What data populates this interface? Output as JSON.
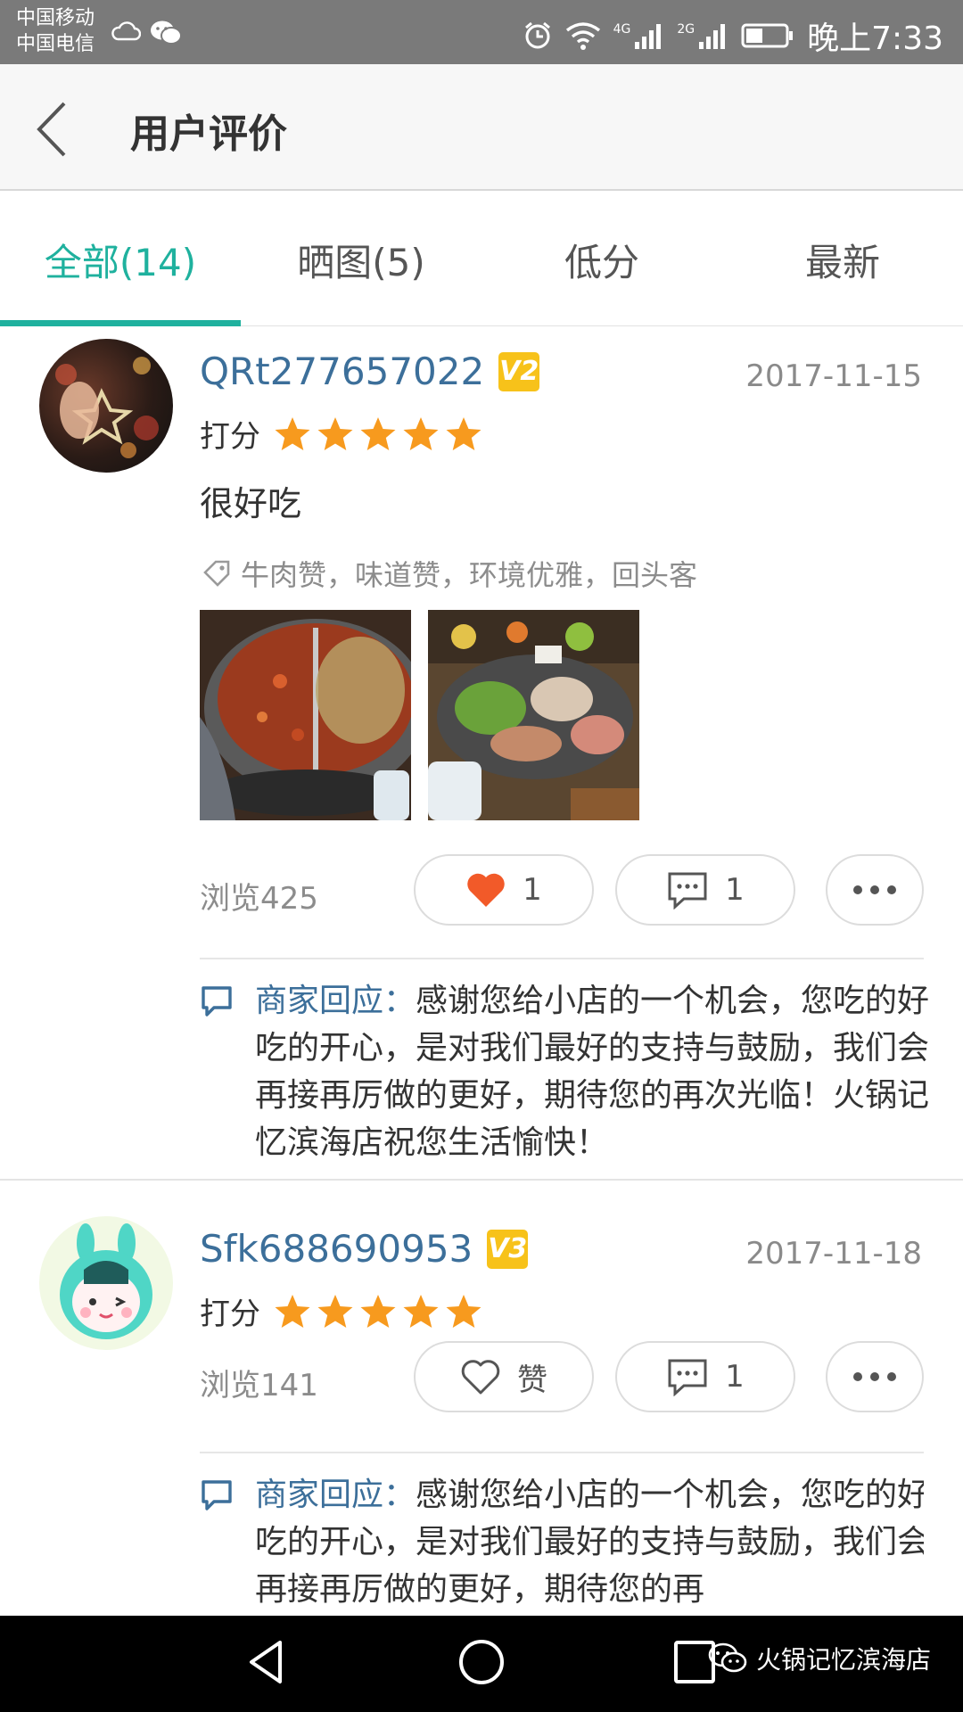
{
  "status_bar": {
    "carrier_1": "中国移动",
    "carrier_2": "中国电信",
    "network_1": "4G",
    "network_2": "2G",
    "time": "晚上7:33"
  },
  "header": {
    "title": "用户评价",
    "back_icon": "chevron-left-icon"
  },
  "tabs": [
    {
      "label": "全部(14)",
      "active": true
    },
    {
      "label": "晒图(5)",
      "active": false
    },
    {
      "label": "低分",
      "active": false
    },
    {
      "label": "最新",
      "active": false
    }
  ],
  "reviews": [
    {
      "username": "QRt277657022",
      "level_badge": "V2",
      "date": "2017-11-15",
      "rating_label": "打分",
      "stars": 5,
      "comment": "很好吃",
      "tags": "牛肉赞，味道赞，环境优雅，回头客",
      "photo_count": 2,
      "views": "浏览425",
      "like_label": "1",
      "liked": true,
      "comment_count": "1",
      "reply_label": "商家回应：",
      "reply_text": "感谢您给小店的一个机会，您吃的好吃的开心，是对我们最好的支持与鼓励，我们会再接再厉做的更好，期待您的再次光临！火锅记忆滨海店祝您生活愉快！"
    },
    {
      "username": "Sfk688690953",
      "level_badge": "V3",
      "date": "2017-11-18",
      "rating_label": "打分",
      "stars": 5,
      "views": "浏览141",
      "like_label": "赞",
      "liked": false,
      "comment_count": "1",
      "reply_label": "商家回应：",
      "reply_text": "感谢您给小店的一个机会，您吃的好吃的开心，是对我们最好的支持与鼓励，我们会再接再厉做的更好，期待您的再"
    }
  ],
  "watermark": "火锅记忆滨海店",
  "colors": {
    "accent": "#1fb19e",
    "link": "#3c6f9a",
    "star": "#f79a1e",
    "heart": "#f25a29",
    "badge": "#f7c21a"
  }
}
